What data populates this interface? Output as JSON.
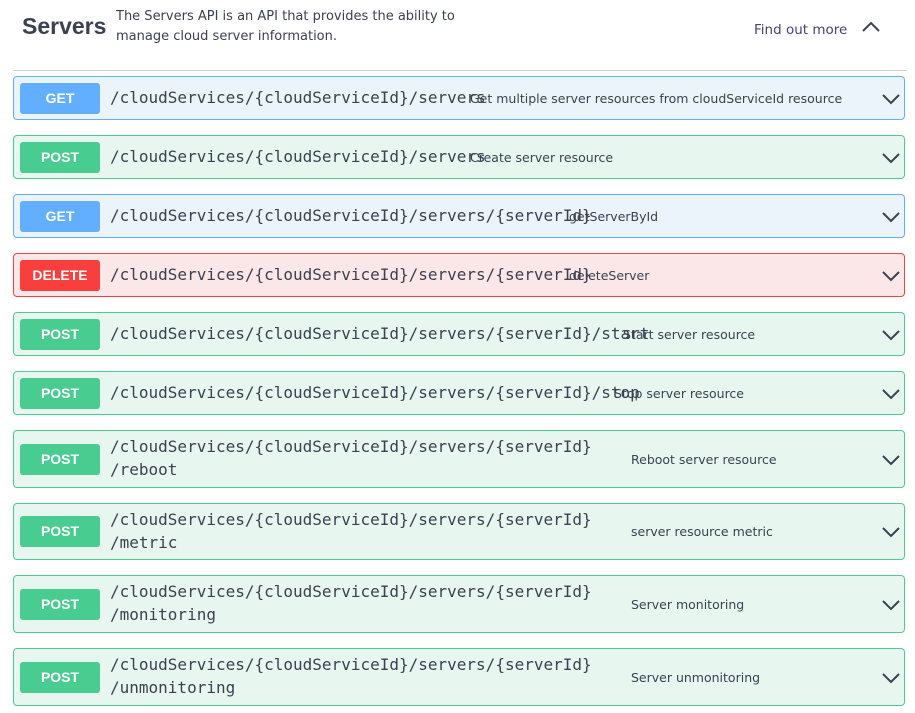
{
  "tag": {
    "title": "Servers",
    "description": "The Servers API is an API that provides the ability to manage cloud server information.",
    "find_out_more": "Find out more"
  },
  "operations": [
    {
      "method": "GET",
      "path": "/cloudServices/{cloudServiceId}/servers",
      "summary": "Get multiple server resources from cloudServiceId resource"
    },
    {
      "method": "POST",
      "path": "/cloudServices/{cloudServiceId}/servers",
      "summary": "Create server resource"
    },
    {
      "method": "GET",
      "path": "/cloudServices/{cloudServiceId}/servers/{serverId}",
      "summary": "getServerById"
    },
    {
      "method": "DELETE",
      "path": "/cloudServices/{cloudServiceId}/servers/{serverId}",
      "summary": "deleteServer"
    },
    {
      "method": "POST",
      "path": "/cloudServices/{cloudServiceId}/servers/{serverId}/start",
      "summary": "Start server resource"
    },
    {
      "method": "POST",
      "path": "/cloudServices/{cloudServiceId}/servers/{serverId}/stop",
      "summary": "Stop server resource"
    },
    {
      "method": "POST",
      "path_line1": "/cloudServices/{cloudServiceId}/servers/{serverId}",
      "path_line2": "/reboot",
      "summary": "Reboot server resource"
    },
    {
      "method": "POST",
      "path_line1": "/cloudServices/{cloudServiceId}/servers/{serverId}",
      "path_line2": "/metric",
      "summary": "server resource metric"
    },
    {
      "method": "POST",
      "path_line1": "/cloudServices/{cloudServiceId}/servers/{serverId}",
      "path_line2": "/monitoring",
      "summary": "Server monitoring"
    },
    {
      "method": "POST",
      "path_line1": "/cloudServices/{cloudServiceId}/servers/{serverId}",
      "path_line2": "/unmonitoring",
      "summary": "Server unmonitoring"
    }
  ],
  "icons": {
    "collapse": "chevron-up-icon",
    "expand": "chevron-down-icon"
  },
  "colors": {
    "get": "#61affe",
    "post": "#49cc90",
    "delete": "#f93e3e",
    "text": "#3b4151"
  }
}
